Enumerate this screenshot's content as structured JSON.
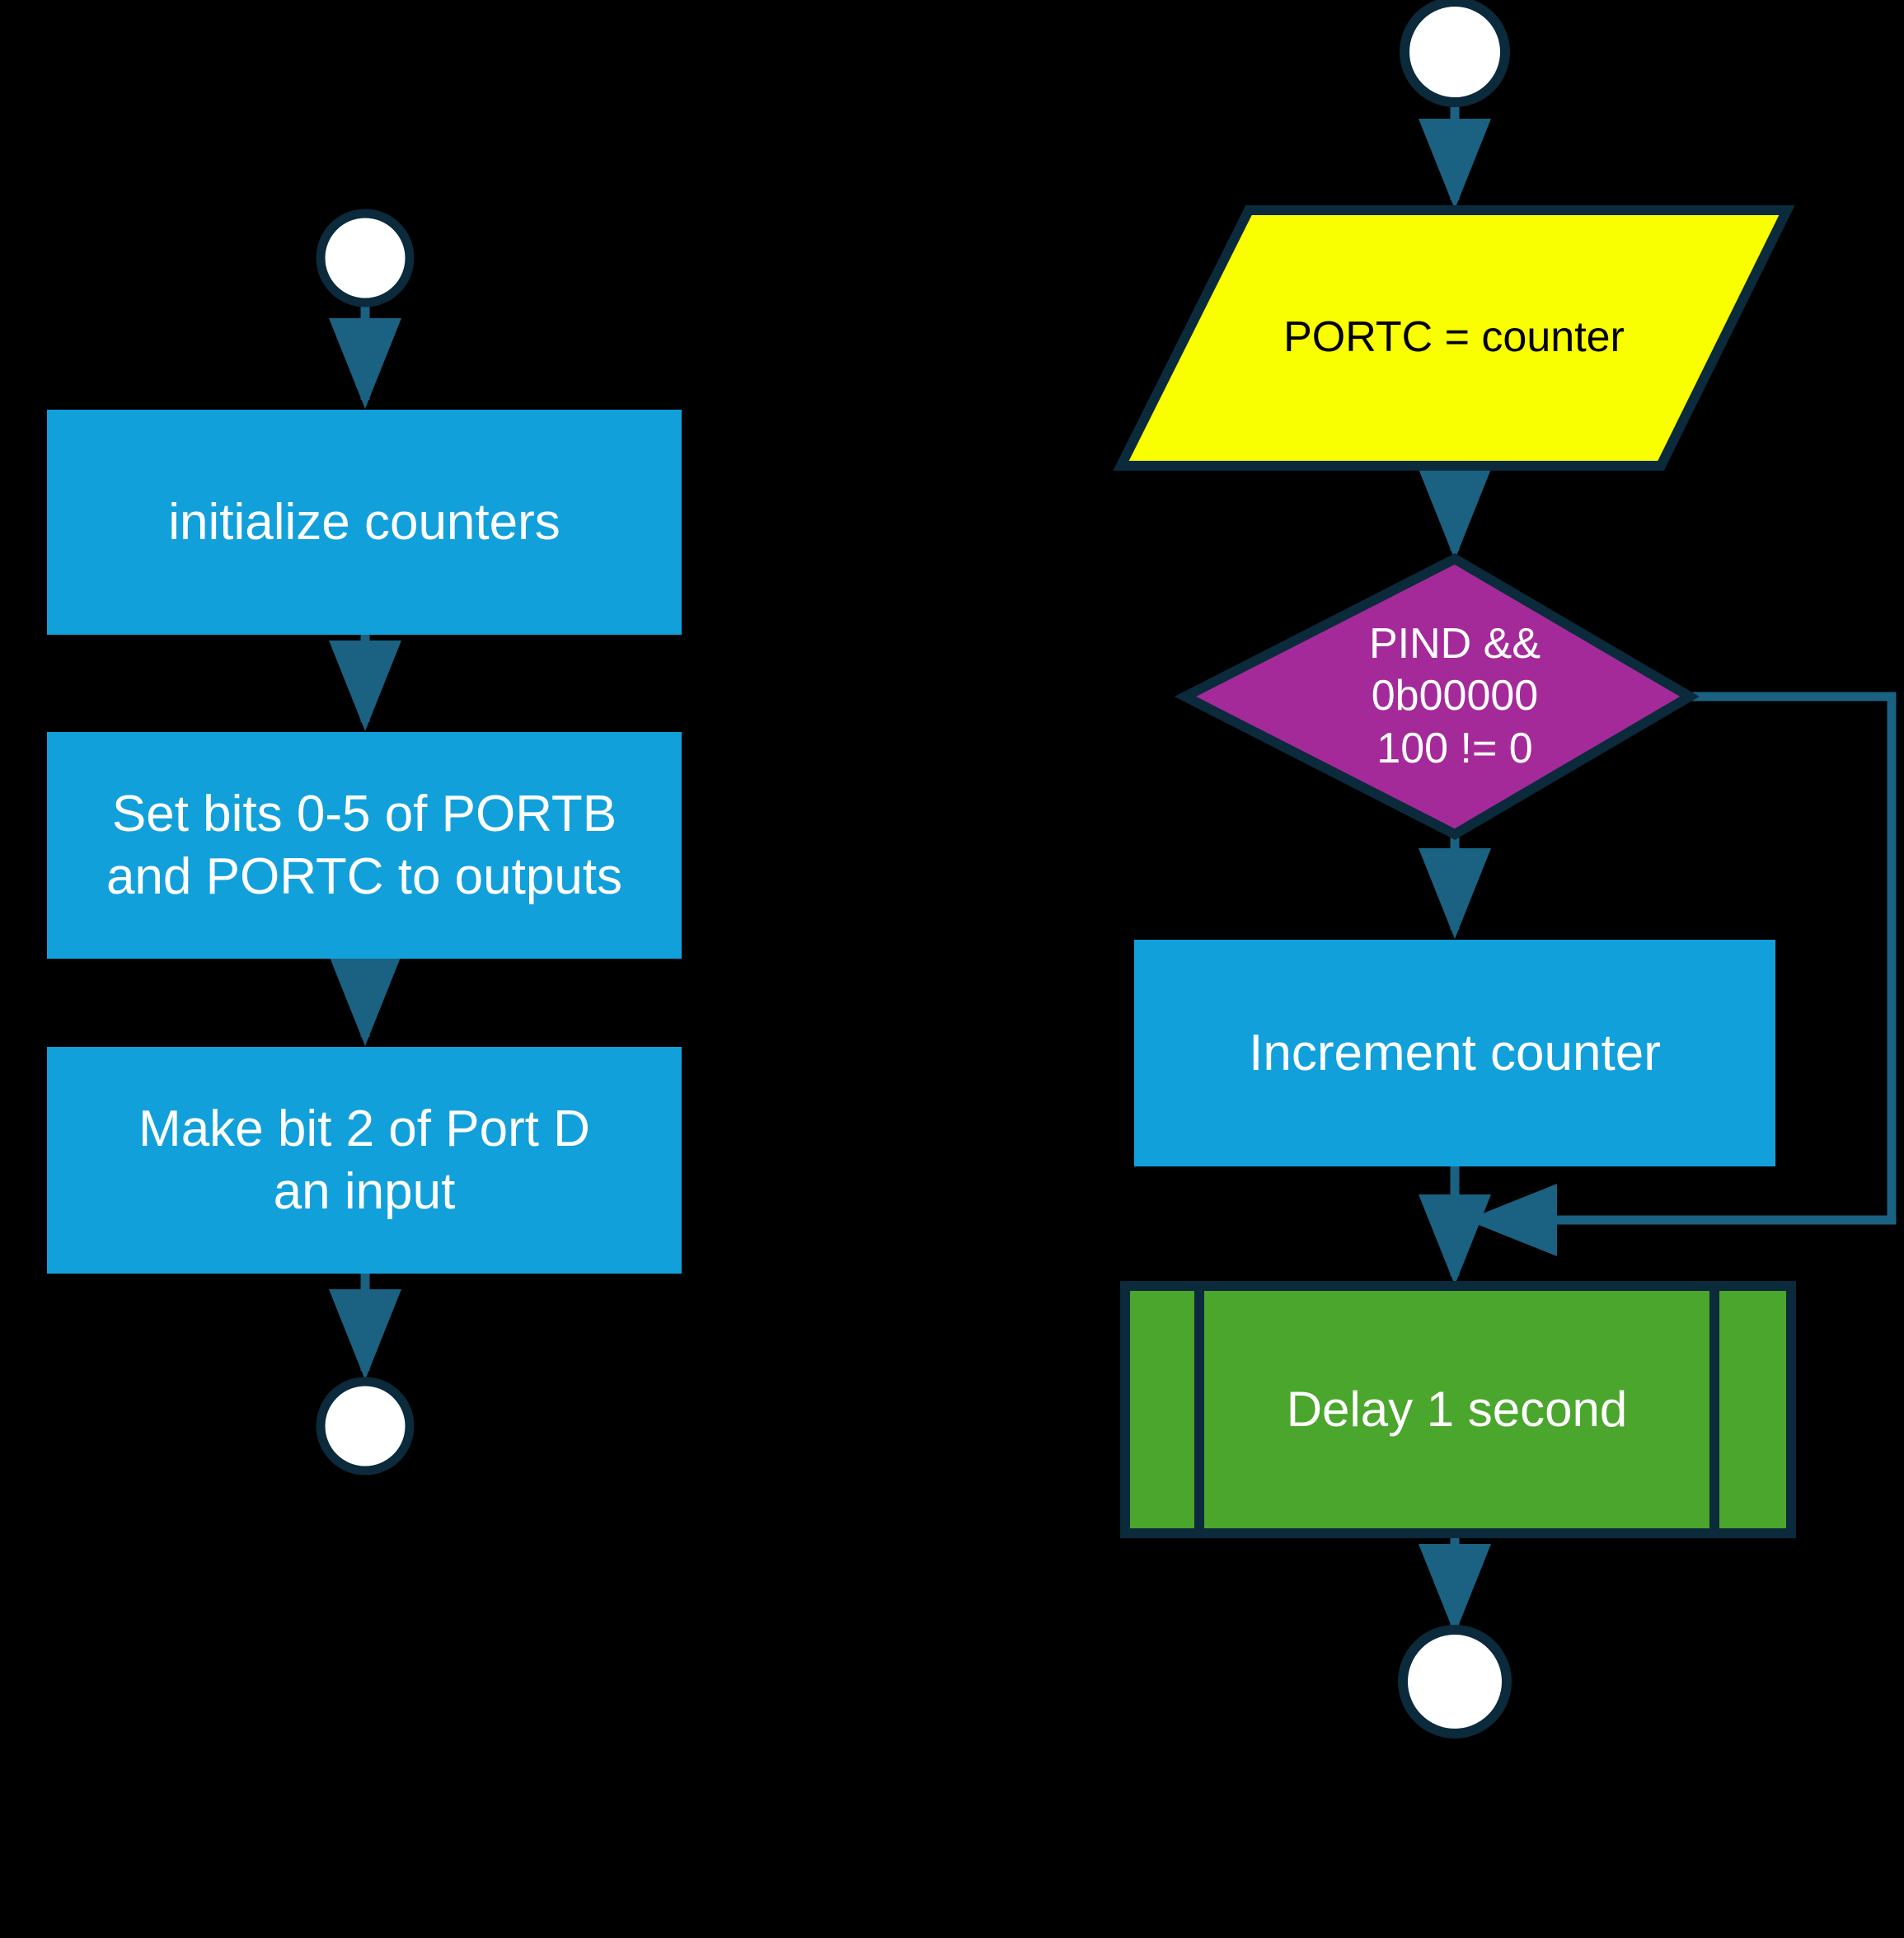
{
  "diagram": {
    "type": "flowchart",
    "background_color": "#000000",
    "palette": {
      "process_fill": "#12A0DB",
      "io_fill": "#FAFF00",
      "decision_fill": "#A42A9A",
      "subroutine_fill": "#4AA62C",
      "terminator_fill": "#FFFFFF",
      "outline": "#0B2A3B",
      "connector": "#1A6182",
      "text_light": "#FFFFFF",
      "text_dark": "#000000"
    },
    "flows": [
      {
        "name": "setup",
        "nodes": [
          {
            "id": "start-setup",
            "shape": "terminator",
            "label": ""
          },
          {
            "id": "init-counters",
            "shape": "process",
            "label": "initialize counters"
          },
          {
            "id": "set-outputs",
            "shape": "process",
            "label": "Set bits 0-5 of PORTB\nand PORTC to outputs"
          },
          {
            "id": "make-input",
            "shape": "process",
            "label": "Make bit 2 of Port D\nan input"
          },
          {
            "id": "end-setup",
            "shape": "terminator",
            "label": ""
          }
        ]
      },
      {
        "name": "loop",
        "nodes": [
          {
            "id": "start-loop",
            "shape": "terminator",
            "label": ""
          },
          {
            "id": "portc-assign",
            "shape": "input-output",
            "label": "PORTC = counter"
          },
          {
            "id": "pind-check",
            "shape": "decision",
            "label": "PIND &&\n0b00000\n100 != 0"
          },
          {
            "id": "increment-counter",
            "shape": "process",
            "label": "Increment counter"
          },
          {
            "id": "delay-one-second",
            "shape": "subroutine",
            "label": "Delay 1 second"
          },
          {
            "id": "end-loop",
            "shape": "terminator",
            "label": ""
          }
        ]
      }
    ],
    "edges": [
      {
        "from": "start-setup",
        "to": "init-counters",
        "label": ""
      },
      {
        "from": "init-counters",
        "to": "set-outputs",
        "label": ""
      },
      {
        "from": "set-outputs",
        "to": "make-input",
        "label": ""
      },
      {
        "from": "make-input",
        "to": "end-setup",
        "label": ""
      },
      {
        "from": "start-loop",
        "to": "portc-assign",
        "label": ""
      },
      {
        "from": "portc-assign",
        "to": "pind-check",
        "label": ""
      },
      {
        "from": "pind-check",
        "to": "increment-counter",
        "label": ""
      },
      {
        "from": "pind-check",
        "to": "delay-one-second",
        "label": ""
      },
      {
        "from": "increment-counter",
        "to": "delay-one-second",
        "label": ""
      },
      {
        "from": "delay-one-second",
        "to": "end-loop",
        "label": ""
      }
    ]
  }
}
